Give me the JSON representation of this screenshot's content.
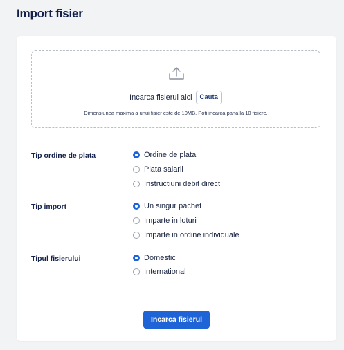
{
  "page": {
    "title": "Import fisier"
  },
  "upload": {
    "prompt": "Incarca fisierul aici",
    "browse_label": "Cauta",
    "hint": "Dimensiunea maxima a unui fisier este de 10MB. Poti incarca pana la 10 fisiere.",
    "icon": "upload-icon"
  },
  "groups": [
    {
      "label": "Tip ordine de plata",
      "options": [
        {
          "label": "Ordine de plata",
          "checked": true
        },
        {
          "label": "Plata salarii",
          "checked": false
        },
        {
          "label": "Instructiuni debit direct",
          "checked": false
        }
      ]
    },
    {
      "label": "Tip import",
      "options": [
        {
          "label": "Un singur pachet",
          "checked": true
        },
        {
          "label": "Imparte in loturi",
          "checked": false
        },
        {
          "label": "Imparte in ordine individuale",
          "checked": false
        }
      ]
    },
    {
      "label": "Tipul fisierului",
      "options": [
        {
          "label": "Domestic",
          "checked": true
        },
        {
          "label": "International",
          "checked": false
        }
      ]
    }
  ],
  "footer": {
    "submit_label": "Incarca fisierul"
  },
  "colors": {
    "accent": "#1f64d6",
    "title": "#13204a",
    "background": "#f2f3f5"
  }
}
